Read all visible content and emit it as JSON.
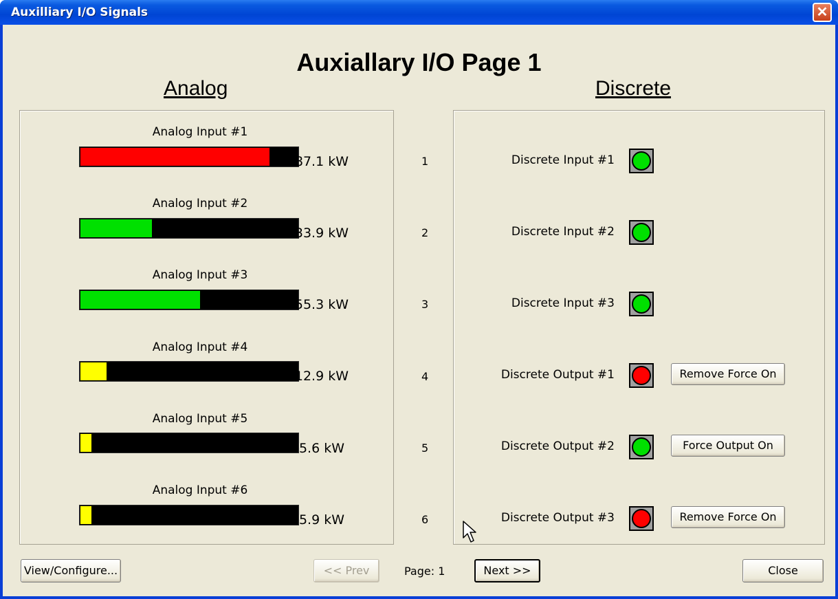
{
  "window": {
    "title": "Auxilliary I/O Signals"
  },
  "page_title": "Auxiallary I/O Page 1",
  "analog": {
    "title": "Analog",
    "items": [
      {
        "label": "Analog Input #1",
        "value": "87.1 kW",
        "fill_fraction": 0.87,
        "color": "#ff0000"
      },
      {
        "label": "Analog Input #2",
        "value": "33.9 kW",
        "fill_fraction": 0.33,
        "color": "#00e000"
      },
      {
        "label": "Analog Input #3",
        "value": "55.3 kW",
        "fill_fraction": 0.55,
        "color": "#00e000"
      },
      {
        "label": "Analog Input #4",
        "value": "12.9 kW",
        "fill_fraction": 0.12,
        "color": "#ffff00"
      },
      {
        "label": "Analog Input #5",
        "value": "5.6 kW",
        "fill_fraction": 0.05,
        "color": "#ffff00"
      },
      {
        "label": "Analog Input #6",
        "value": "5.9 kW",
        "fill_fraction": 0.05,
        "color": "#ffff00"
      }
    ]
  },
  "row_numbers": [
    "1",
    "2",
    "3",
    "4",
    "5",
    "6"
  ],
  "discrete": {
    "title": "Discrete",
    "items": [
      {
        "label": "Discrete Input #1",
        "state_color": "#00e000",
        "button": ""
      },
      {
        "label": "Discrete Input #2",
        "state_color": "#00e000",
        "button": ""
      },
      {
        "label": "Discrete Input #3",
        "state_color": "#00e000",
        "button": ""
      },
      {
        "label": "Discrete Output #1",
        "state_color": "#ff0000",
        "button": "Remove Force On"
      },
      {
        "label": "Discrete Output #2",
        "state_color": "#00e000",
        "button": "Force Output On"
      },
      {
        "label": "Discrete Output #3",
        "state_color": "#ff0000",
        "button": "Remove Force On"
      }
    ]
  },
  "footer": {
    "view_configure": "View/Configure...",
    "prev": "<< Prev",
    "page_label": "Page: 1",
    "next": "Next >>",
    "close": "Close"
  },
  "icons": {
    "close": "close-icon",
    "cursor": "mouse-cursor-icon"
  }
}
